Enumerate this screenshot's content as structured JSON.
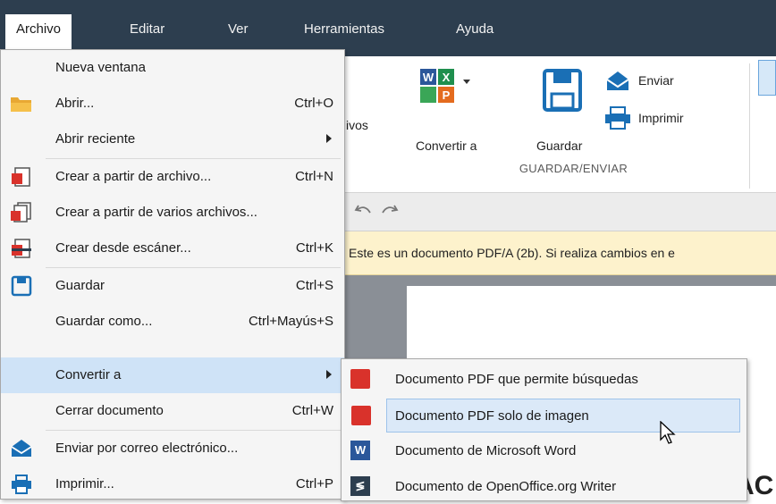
{
  "menubar": {
    "items": [
      "Archivo",
      "Editar",
      "Ver",
      "Herramientas",
      "Ayuda"
    ]
  },
  "ribbon": {
    "partial_label": "ivos",
    "convert_label": "Convertir a",
    "save_label": "Guardar",
    "send_label": "Enviar",
    "print_label": "Imprimir",
    "group_label": "GUARDAR/ENVIAR"
  },
  "notice": {
    "text": "Este es un documento PDF/A (2b). Si realiza cambios en e"
  },
  "file_menu": {
    "items": [
      {
        "label": "Nueva ventana",
        "shortcut": ""
      },
      {
        "label": "Abrir...",
        "shortcut": "Ctrl+O"
      },
      {
        "label": "Abrir reciente",
        "shortcut": ""
      },
      {
        "label": "Crear a partir de archivo...",
        "shortcut": "Ctrl+N"
      },
      {
        "label": "Crear a partir de varios archivos...",
        "shortcut": ""
      },
      {
        "label": "Crear desde escáner...",
        "shortcut": "Ctrl+K"
      },
      {
        "label": "Guardar",
        "shortcut": "Ctrl+S"
      },
      {
        "label": "Guardar como...",
        "shortcut": "Ctrl+Mayús+S"
      },
      {
        "label": "Convertir a",
        "shortcut": ""
      },
      {
        "label": "Cerrar documento",
        "shortcut": "Ctrl+W"
      },
      {
        "label": "Enviar por correo electrónico...",
        "shortcut": ""
      },
      {
        "label": "Imprimir...",
        "shortcut": "Ctrl+P"
      }
    ]
  },
  "convert_submenu": {
    "items": [
      {
        "label": "Documento PDF que permite búsquedas"
      },
      {
        "label": "Documento PDF solo de imagen"
      },
      {
        "label": "Documento de Microsoft Word"
      },
      {
        "label": "Documento de OpenOffice.org Writer"
      }
    ]
  },
  "background_text": "AC",
  "colors": {
    "menubar": "#2d3e4f",
    "highlight": "#cfe3f7",
    "notice": "#fdf2cc",
    "pdf_red": "#d9322b",
    "word_blue": "#2b579a"
  }
}
